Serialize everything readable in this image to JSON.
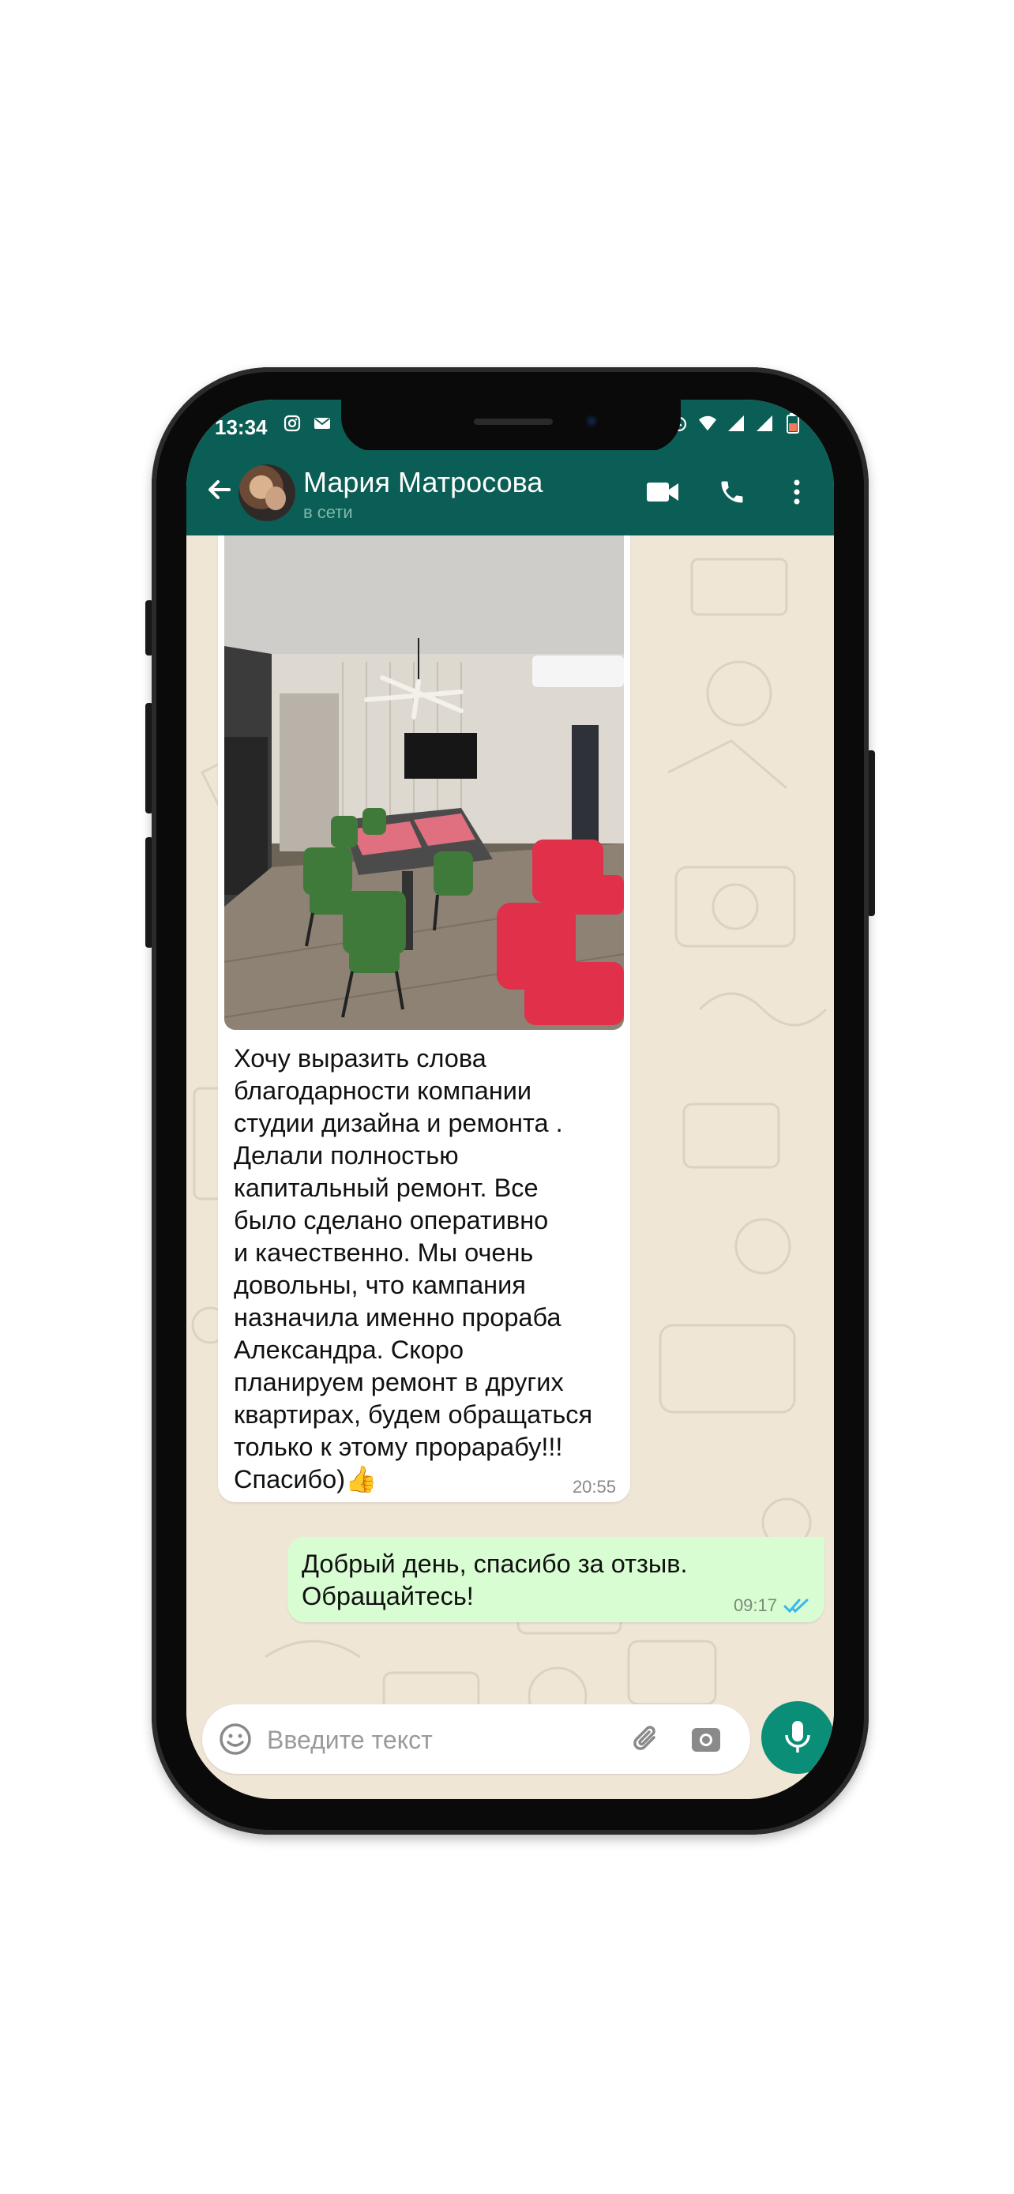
{
  "status_bar": {
    "time": "13:34",
    "icons_left": [
      "instagram-icon",
      "mail-icon"
    ],
    "icons_right": [
      "alarm-icon",
      "wifi-icon",
      "signal-icon",
      "signal-icon-2",
      "battery-icon"
    ]
  },
  "header": {
    "contact_name": "Мария Матросова",
    "contact_status": "в сети",
    "icons": [
      "back-arrow-icon",
      "video-call-icon",
      "phone-icon",
      "more-vert-icon"
    ]
  },
  "messages": [
    {
      "direction": "incoming",
      "has_image": true,
      "text": "Хочу выразить слова\nблагодарности компании\nстудии дизайна и ремонта .\nДелали полностью\nкапитальный ремонт. Все\nбыло сделано оперативно\nи качественно. Мы очень\nдовольны, что кампания\nназначила именно прораба\nАлександра. Скоро\nпланируем ремонт в других\nквартирах, будем обращаться\nтолько к этому прорарабу!!!",
      "text_last_line": "Спасибо)👍",
      "time": "20:55"
    },
    {
      "direction": "outgoing",
      "text": "Добрый день, спасибо за отзыв.\nОбращайтесь!",
      "time": "09:17",
      "read": true
    }
  ],
  "input": {
    "placeholder": "Введите текст",
    "value": ""
  },
  "colors": {
    "header": "#0b5e55",
    "chat_bg": "#efe6d6",
    "incoming_bubble": "#ffffff",
    "outgoing_bubble": "#d9fdd3",
    "mic_button": "#0b8e78",
    "read_ticks": "#34b7f1"
  }
}
